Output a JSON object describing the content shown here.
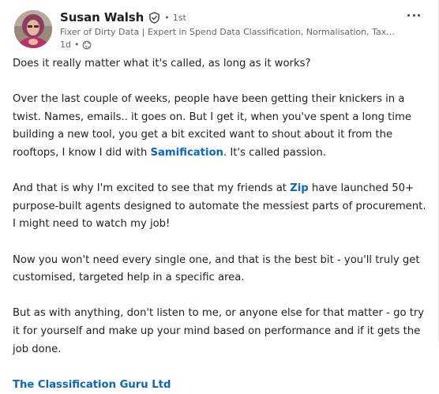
{
  "author": {
    "name": "Susan Walsh",
    "degree": "1st",
    "headline": "Fixer of Dirty Data | Expert in Spend Data Classification, Normalisation, Taxono...",
    "time_ago": "1d",
    "visibility_icon": "globe-icon",
    "verified_icon": "verified-shield-icon"
  },
  "post": {
    "p1": "Does it really matter what it's called, as long as it works?",
    "p2": "Over the last couple of weeks, people have been getting their knickers in a twist. Names, emails.. it goes on. But I get it, when you've spent a long time building a new tool, you get a bit excited want to shout about it from the rooftops, I know I did with ",
    "p2_mention": "Samification",
    "p2_end": ". It's called passion.",
    "p3_start": "And that is why I'm excited to see that my friends at ",
    "p3_mention": "Zip",
    "p3_end": " have launched 50+ purpose-built agents designed to automate the messiest parts of procurement. I might need to watch my job!",
    "p4": "Now you won't need every single one, and that is the best bit - you'll truly get customised, targeted help in a specific area.",
    "p5": "But as with anything, don't listen to me, or anyone else for that matter - go try it for yourself and make up your mind based on performance and if it gets the job done.",
    "p6_mention": "The Classification Guru Ltd"
  },
  "colors": {
    "link": "#0a66c2",
    "text": "#1f1f1f",
    "muted": "#666666"
  }
}
